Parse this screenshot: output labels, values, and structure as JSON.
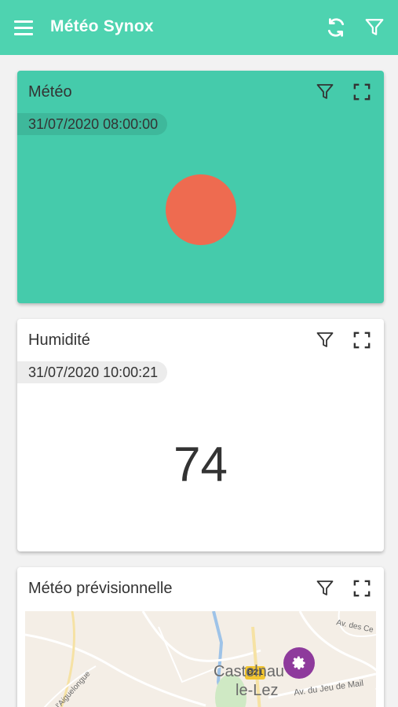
{
  "app": {
    "title": "Météo Synox",
    "accent_color": "#4ed3b0",
    "toolbar": {
      "menu_icon": "menu-icon",
      "refresh_icon": "refresh-icon",
      "filter_icon": "filter-icon"
    }
  },
  "cards": [
    {
      "title": "Météo",
      "timestamp": "31/07/2020 08:00:00",
      "background_color": "#45cbab",
      "indicator_color": "#ee6b50"
    },
    {
      "title": "Humidité",
      "timestamp": "31/07/2020 10:00:21",
      "value": "74"
    },
    {
      "title": "Météo prévisionnelle",
      "map": {
        "town_line1": "Castelnau",
        "town_line2": "le-Lez",
        "road_badge": "D21",
        "street_1": "Av. des Ce",
        "street_2": "Av. du Jeu de Mail",
        "street_3": "de l'Aiguelongue",
        "marker_color": "#8e3a9c"
      }
    }
  ]
}
